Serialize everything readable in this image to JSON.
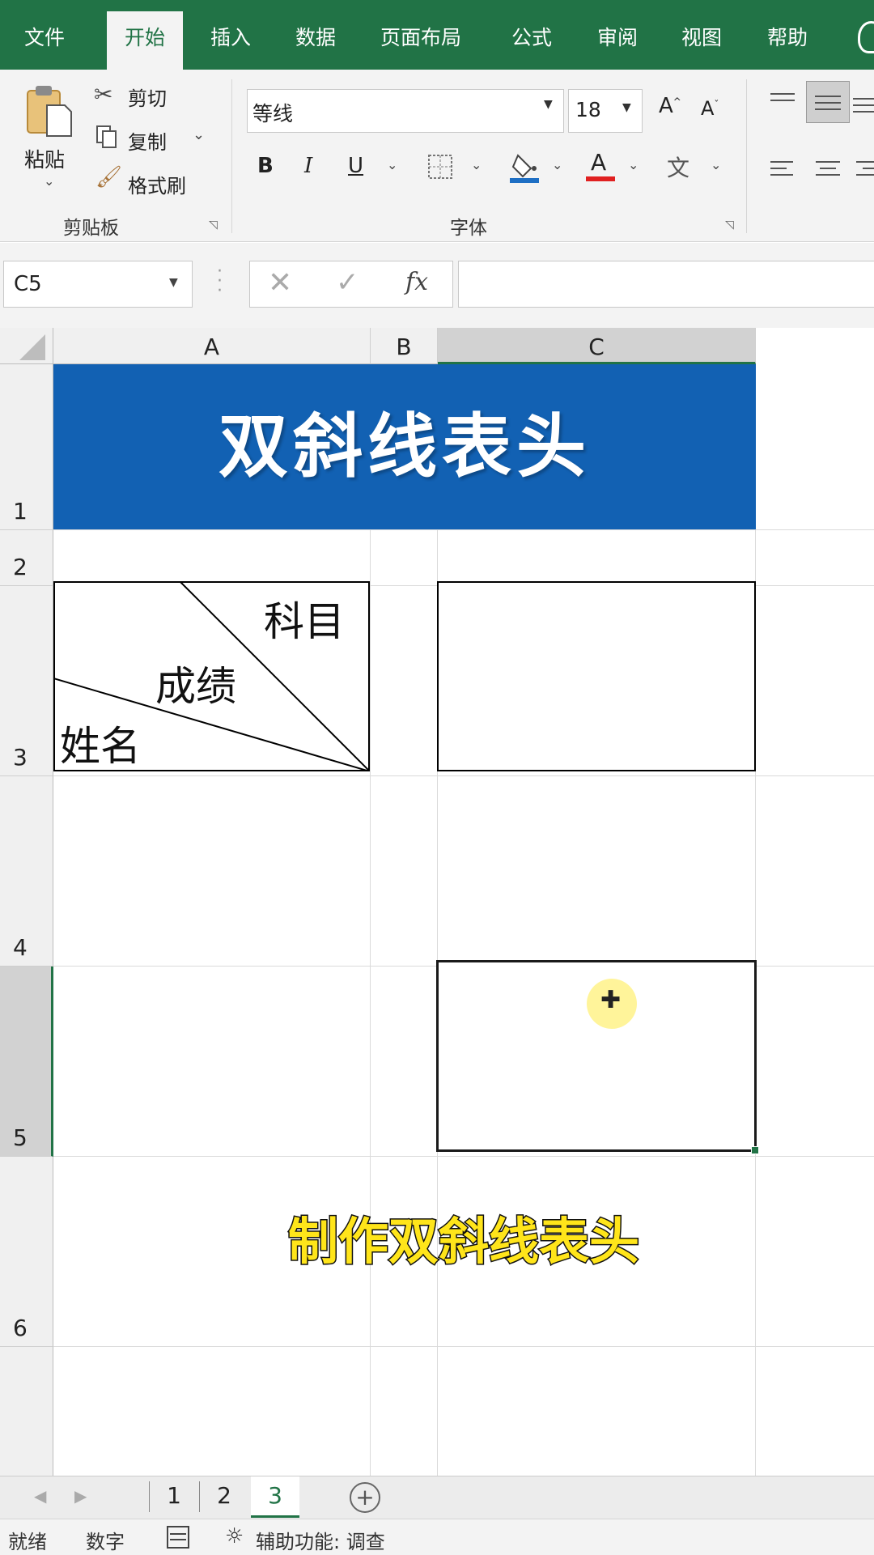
{
  "tabs": [
    "文件",
    "开始",
    "插入",
    "数据",
    "页面布局",
    "公式",
    "审阅",
    "视图",
    "帮助"
  ],
  "clipboard": {
    "paste": "粘贴",
    "cut": "剪切",
    "copy": "复制",
    "format_painter": "格式刷",
    "group_label": "剪贴板"
  },
  "font": {
    "name": "等线",
    "size": "18",
    "group_label": "字体",
    "font_color": "#e02020",
    "fill_color": "#1e6fc4"
  },
  "name_box": "C5",
  "sheet": {
    "columns": [
      "A",
      "B",
      "C"
    ],
    "rows": [
      "1",
      "2",
      "3",
      "4",
      "5",
      "6"
    ],
    "title": "双斜线表头",
    "title_bg": "#1261b3",
    "header_labels": {
      "subject": "科目",
      "score": "成绩",
      "name": "姓名"
    },
    "caption": "制作双斜线表头"
  },
  "sheet_tabs": [
    "1",
    "2",
    "3"
  ],
  "active_sheet": "3",
  "status": {
    "ready": "就绪",
    "mode": "数字",
    "accessibility": "辅助功能: 调查"
  }
}
